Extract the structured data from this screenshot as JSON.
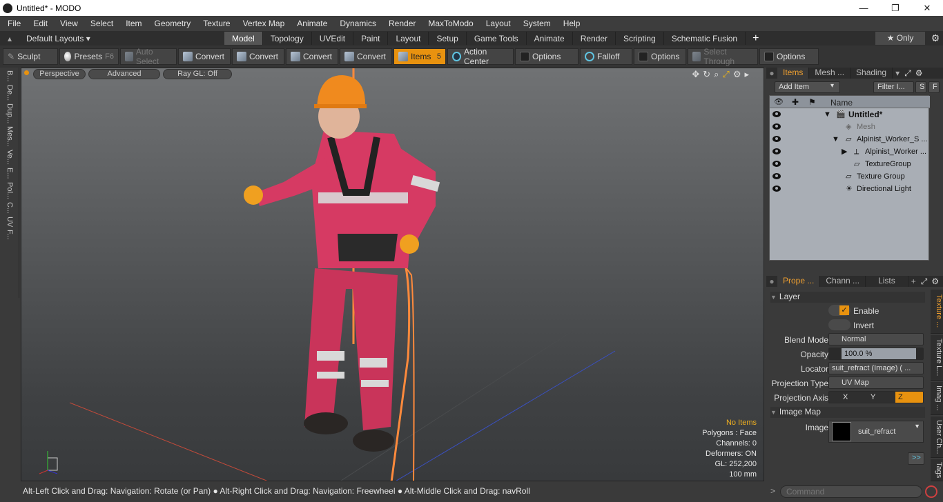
{
  "window": {
    "title": "Untitled* - MODO",
    "minimize": "—",
    "maximize": "❐",
    "close": "✕"
  },
  "menu": [
    "File",
    "Edit",
    "View",
    "Select",
    "Item",
    "Geometry",
    "Texture",
    "Vertex Map",
    "Animate",
    "Dynamics",
    "Render",
    "MaxToModo",
    "Layout",
    "System",
    "Help"
  ],
  "layoutbar": {
    "layouts_label": "Default Layouts ▾",
    "tabs": [
      "Model",
      "Topology",
      "UVEdit",
      "Paint",
      "Layout",
      "Setup",
      "Game Tools",
      "Animate",
      "Render",
      "Scripting",
      "Schematic Fusion"
    ],
    "add": "+",
    "only": "★  Only"
  },
  "toolbar": {
    "sculpt": "Sculpt",
    "presets": "Presets",
    "presets_key": "F6",
    "auto_select": "Auto Select",
    "convert1": "Convert",
    "convert2": "Convert",
    "convert3": "Convert",
    "convert4": "Convert",
    "items": "Items",
    "items_key": "5",
    "action_center": "Action Center",
    "options1": "Options",
    "falloff": "Falloff",
    "options2": "Options",
    "select_through": "Select Through",
    "options3": "Options"
  },
  "leftstrip": [
    "B...",
    "De...",
    "Dup...",
    "Mes...",
    "Ve...",
    "E...",
    "Pol...",
    "C...",
    "UV",
    "F..."
  ],
  "viewport": {
    "perspective": "Perspective",
    "advanced": "Advanced",
    "raygl": "Ray GL: Off",
    "info": {
      "no_items": "No Items",
      "polygons": "Polygons : Face",
      "channels": "Channels: 0",
      "deformers": "Deformers: ON",
      "gl": "GL: 252,200",
      "scale": "100 mm"
    }
  },
  "items_panel": {
    "tabs": [
      "Items",
      "Mesh ...",
      "Shading"
    ],
    "add_item": "Add Item",
    "filter": "Filter I...",
    "s_btn": "S",
    "f_btn": "F",
    "name_header": "Name",
    "rows": [
      {
        "label": "Untitled*",
        "bold": true
      },
      {
        "label": "Mesh",
        "dim": true
      },
      {
        "label": "Alpinist_Worker_S ..."
      },
      {
        "label": "Alpinist_Worker ..."
      },
      {
        "label": "TextureGroup"
      },
      {
        "label": "Texture Group"
      },
      {
        "label": "Directional Light"
      }
    ]
  },
  "props_panel": {
    "tabs": [
      "Prope ...",
      "Chann ...",
      "Lists"
    ],
    "section_layer": "Layer",
    "enable": "Enable",
    "invert": "Invert",
    "blend_mode_label": "Blend Mode",
    "blend_mode": "Normal",
    "opacity_label": "Opacity",
    "opacity": "100.0 %",
    "locator_label": "Locator",
    "locator": "suit_refract (Image) ( ...",
    "projection_type_label": "Projection Type",
    "projection_type": "UV Map",
    "projection_axis_label": "Projection Axis",
    "axis_x": "X",
    "axis_y": "Y",
    "axis_z": "Z",
    "section_image_map": "Image Map",
    "image_label": "Image",
    "image": "suit_refract",
    "more": ">>",
    "side_tabs": [
      "Texture ...",
      "Texture L...",
      "Imag ...",
      "User Ch...",
      "Tags"
    ]
  },
  "status": {
    "hint": "Alt-Left Click and Drag: Navigation: Rotate (or Pan) ● Alt-Right Click and Drag: Navigation: Freewheel ● Alt-Middle Click and Drag: navRoll"
  },
  "command": {
    "placeholder": "Command"
  },
  "colors": {
    "accent": "#e8920f",
    "suit": "#d63a63",
    "helmet": "#f08a1e",
    "rope": "#ff8a3c"
  }
}
